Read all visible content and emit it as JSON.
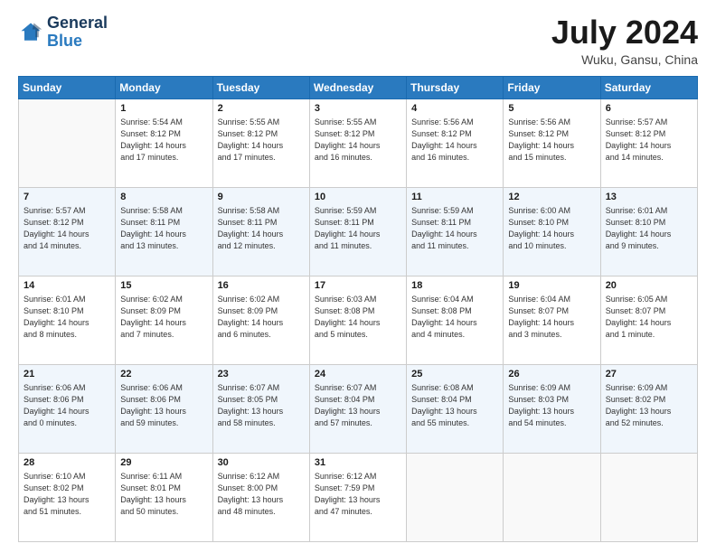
{
  "header": {
    "logo_line1": "General",
    "logo_line2": "Blue",
    "month": "July 2024",
    "location": "Wuku, Gansu, China"
  },
  "weekdays": [
    "Sunday",
    "Monday",
    "Tuesday",
    "Wednesday",
    "Thursday",
    "Friday",
    "Saturday"
  ],
  "weeks": [
    [
      {
        "day": "",
        "sunrise": "",
        "sunset": "",
        "daylight": ""
      },
      {
        "day": "1",
        "sunrise": "Sunrise: 5:54 AM",
        "sunset": "Sunset: 8:12 PM",
        "daylight": "Daylight: 14 hours and 17 minutes."
      },
      {
        "day": "2",
        "sunrise": "Sunrise: 5:55 AM",
        "sunset": "Sunset: 8:12 PM",
        "daylight": "Daylight: 14 hours and 17 minutes."
      },
      {
        "day": "3",
        "sunrise": "Sunrise: 5:55 AM",
        "sunset": "Sunset: 8:12 PM",
        "daylight": "Daylight: 14 hours and 16 minutes."
      },
      {
        "day": "4",
        "sunrise": "Sunrise: 5:56 AM",
        "sunset": "Sunset: 8:12 PM",
        "daylight": "Daylight: 14 hours and 16 minutes."
      },
      {
        "day": "5",
        "sunrise": "Sunrise: 5:56 AM",
        "sunset": "Sunset: 8:12 PM",
        "daylight": "Daylight: 14 hours and 15 minutes."
      },
      {
        "day": "6",
        "sunrise": "Sunrise: 5:57 AM",
        "sunset": "Sunset: 8:12 PM",
        "daylight": "Daylight: 14 hours and 14 minutes."
      }
    ],
    [
      {
        "day": "7",
        "sunrise": "Sunrise: 5:57 AM",
        "sunset": "Sunset: 8:12 PM",
        "daylight": "Daylight: 14 hours and 14 minutes."
      },
      {
        "day": "8",
        "sunrise": "Sunrise: 5:58 AM",
        "sunset": "Sunset: 8:11 PM",
        "daylight": "Daylight: 14 hours and 13 minutes."
      },
      {
        "day": "9",
        "sunrise": "Sunrise: 5:58 AM",
        "sunset": "Sunset: 8:11 PM",
        "daylight": "Daylight: 14 hours and 12 minutes."
      },
      {
        "day": "10",
        "sunrise": "Sunrise: 5:59 AM",
        "sunset": "Sunset: 8:11 PM",
        "daylight": "Daylight: 14 hours and 11 minutes."
      },
      {
        "day": "11",
        "sunrise": "Sunrise: 5:59 AM",
        "sunset": "Sunset: 8:11 PM",
        "daylight": "Daylight: 14 hours and 11 minutes."
      },
      {
        "day": "12",
        "sunrise": "Sunrise: 6:00 AM",
        "sunset": "Sunset: 8:10 PM",
        "daylight": "Daylight: 14 hours and 10 minutes."
      },
      {
        "day": "13",
        "sunrise": "Sunrise: 6:01 AM",
        "sunset": "Sunset: 8:10 PM",
        "daylight": "Daylight: 14 hours and 9 minutes."
      }
    ],
    [
      {
        "day": "14",
        "sunrise": "Sunrise: 6:01 AM",
        "sunset": "Sunset: 8:10 PM",
        "daylight": "Daylight: 14 hours and 8 minutes."
      },
      {
        "day": "15",
        "sunrise": "Sunrise: 6:02 AM",
        "sunset": "Sunset: 8:09 PM",
        "daylight": "Daylight: 14 hours and 7 minutes."
      },
      {
        "day": "16",
        "sunrise": "Sunrise: 6:02 AM",
        "sunset": "Sunset: 8:09 PM",
        "daylight": "Daylight: 14 hours and 6 minutes."
      },
      {
        "day": "17",
        "sunrise": "Sunrise: 6:03 AM",
        "sunset": "Sunset: 8:08 PM",
        "daylight": "Daylight: 14 hours and 5 minutes."
      },
      {
        "day": "18",
        "sunrise": "Sunrise: 6:04 AM",
        "sunset": "Sunset: 8:08 PM",
        "daylight": "Daylight: 14 hours and 4 minutes."
      },
      {
        "day": "19",
        "sunrise": "Sunrise: 6:04 AM",
        "sunset": "Sunset: 8:07 PM",
        "daylight": "Daylight: 14 hours and 3 minutes."
      },
      {
        "day": "20",
        "sunrise": "Sunrise: 6:05 AM",
        "sunset": "Sunset: 8:07 PM",
        "daylight": "Daylight: 14 hours and 1 minute."
      }
    ],
    [
      {
        "day": "21",
        "sunrise": "Sunrise: 6:06 AM",
        "sunset": "Sunset: 8:06 PM",
        "daylight": "Daylight: 14 hours and 0 minutes."
      },
      {
        "day": "22",
        "sunrise": "Sunrise: 6:06 AM",
        "sunset": "Sunset: 8:06 PM",
        "daylight": "Daylight: 13 hours and 59 minutes."
      },
      {
        "day": "23",
        "sunrise": "Sunrise: 6:07 AM",
        "sunset": "Sunset: 8:05 PM",
        "daylight": "Daylight: 13 hours and 58 minutes."
      },
      {
        "day": "24",
        "sunrise": "Sunrise: 6:07 AM",
        "sunset": "Sunset: 8:04 PM",
        "daylight": "Daylight: 13 hours and 57 minutes."
      },
      {
        "day": "25",
        "sunrise": "Sunrise: 6:08 AM",
        "sunset": "Sunset: 8:04 PM",
        "daylight": "Daylight: 13 hours and 55 minutes."
      },
      {
        "day": "26",
        "sunrise": "Sunrise: 6:09 AM",
        "sunset": "Sunset: 8:03 PM",
        "daylight": "Daylight: 13 hours and 54 minutes."
      },
      {
        "day": "27",
        "sunrise": "Sunrise: 6:09 AM",
        "sunset": "Sunset: 8:02 PM",
        "daylight": "Daylight: 13 hours and 52 minutes."
      }
    ],
    [
      {
        "day": "28",
        "sunrise": "Sunrise: 6:10 AM",
        "sunset": "Sunset: 8:02 PM",
        "daylight": "Daylight: 13 hours and 51 minutes."
      },
      {
        "day": "29",
        "sunrise": "Sunrise: 6:11 AM",
        "sunset": "Sunset: 8:01 PM",
        "daylight": "Daylight: 13 hours and 50 minutes."
      },
      {
        "day": "30",
        "sunrise": "Sunrise: 6:12 AM",
        "sunset": "Sunset: 8:00 PM",
        "daylight": "Daylight: 13 hours and 48 minutes."
      },
      {
        "day": "31",
        "sunrise": "Sunrise: 6:12 AM",
        "sunset": "Sunset: 7:59 PM",
        "daylight": "Daylight: 13 hours and 47 minutes."
      },
      {
        "day": "",
        "sunrise": "",
        "sunset": "",
        "daylight": ""
      },
      {
        "day": "",
        "sunrise": "",
        "sunset": "",
        "daylight": ""
      },
      {
        "day": "",
        "sunrise": "",
        "sunset": "",
        "daylight": ""
      }
    ]
  ]
}
